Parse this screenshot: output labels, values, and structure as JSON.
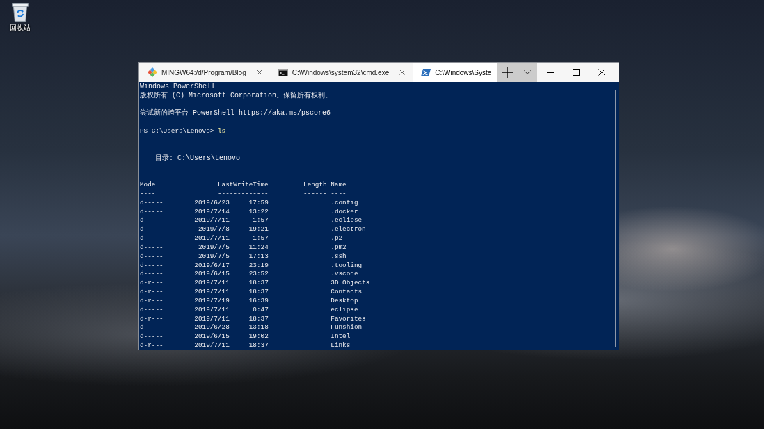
{
  "desktop": {
    "icons": [
      {
        "label": "回收站"
      }
    ]
  },
  "window": {
    "tabs": [
      {
        "kind": "git",
        "title": "MINGW64:/d/Program/Blog",
        "selected": false,
        "close_button": true
      },
      {
        "kind": "cmd",
        "title": "C:\\Windows\\system32\\cmd.exe",
        "selected": false,
        "close_button": true
      },
      {
        "kind": "powershell",
        "title": "C:\\Windows\\Syste",
        "selected": true,
        "close_button": false
      }
    ],
    "terminal": {
      "lines": [
        {
          "kind": "text",
          "text": "Windows PowerShell"
        },
        {
          "kind": "text",
          "text": "版权所有 (C) Microsoft Corporation。保留所有权利。"
        },
        {
          "kind": "blank"
        },
        {
          "kind": "text",
          "text": "尝试新的跨平台 PowerShell https://aka.ms/pscore6"
        },
        {
          "kind": "blank"
        },
        {
          "kind": "prompt",
          "prompt": "PS C:\\Users\\Lenovo>",
          "command": "ls"
        },
        {
          "kind": "blank"
        },
        {
          "kind": "blank"
        },
        {
          "kind": "heading",
          "text": "目录: C:\\Users\\Lenovo"
        },
        {
          "kind": "blank"
        },
        {
          "kind": "blank"
        }
      ],
      "listing": {
        "columns": [
          {
            "label": "Mode",
            "rule": "----"
          },
          {
            "label": "LastWriteTime",
            "rule": "-------------"
          },
          {
            "label": "Length",
            "rule": "------"
          },
          {
            "label": "Name",
            "rule": "----"
          }
        ],
        "rows": [
          {
            "mode": "d-----",
            "date": "2019/6/23",
            "time": "17:59",
            "name": ".config"
          },
          {
            "mode": "d-----",
            "date": "2019/7/14",
            "time": "13:22",
            "name": ".docker"
          },
          {
            "mode": "d-----",
            "date": "2019/7/11",
            "time": "1:57",
            "name": ".eclipse"
          },
          {
            "mode": "d-----",
            "date": "2019/7/8",
            "time": "19:21",
            "name": ".electron"
          },
          {
            "mode": "d-----",
            "date": "2019/7/11",
            "time": "1:57",
            "name": ".p2"
          },
          {
            "mode": "d-----",
            "date": "2019/7/5",
            "time": "11:24",
            "name": ".pm2"
          },
          {
            "mode": "d-----",
            "date": "2019/7/5",
            "time": "17:13",
            "name": ".ssh"
          },
          {
            "mode": "d-----",
            "date": "2019/6/17",
            "time": "23:19",
            "name": ".tooling"
          },
          {
            "mode": "d-----",
            "date": "2019/6/15",
            "time": "23:52",
            "name": ".vscode"
          },
          {
            "mode": "d-r---",
            "date": "2019/7/11",
            "time": "18:37",
            "name": "3D Objects"
          },
          {
            "mode": "d-r---",
            "date": "2019/7/11",
            "time": "18:37",
            "name": "Contacts"
          },
          {
            "mode": "d-r---",
            "date": "2019/7/19",
            "time": "16:39",
            "name": "Desktop"
          },
          {
            "mode": "d-----",
            "date": "2019/7/11",
            "time": "0:47",
            "name": "eclipse"
          },
          {
            "mode": "d-r---",
            "date": "2019/7/11",
            "time": "18:37",
            "name": "Favorites"
          },
          {
            "mode": "d-----",
            "date": "2019/6/28",
            "time": "13:18",
            "name": "Funshion"
          },
          {
            "mode": "d-----",
            "date": "2019/6/15",
            "time": "19:02",
            "name": "Intel"
          },
          {
            "mode": "d-r---",
            "date": "2019/7/11",
            "time": "18:37",
            "name": "Links"
          }
        ]
      }
    }
  }
}
